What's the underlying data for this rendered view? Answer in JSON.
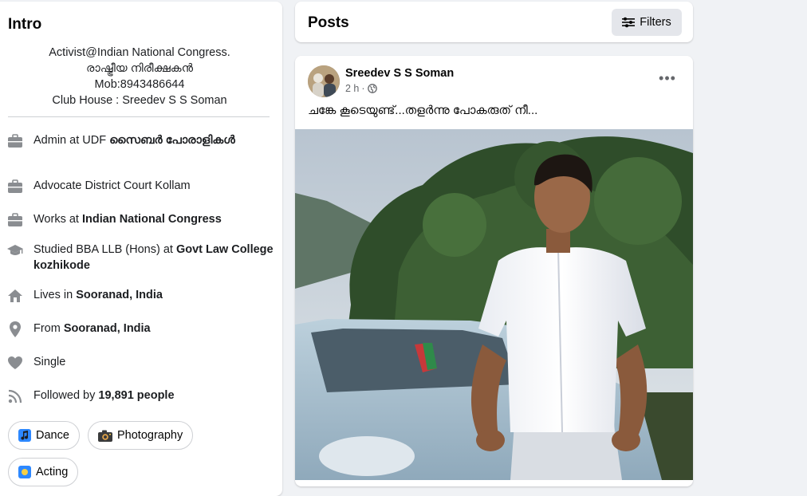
{
  "intro": {
    "title": "Intro",
    "bio": [
      "Activist@Indian National Congress.",
      "രാഷ്ട്രീയ നിരീക്ഷകൻ",
      "Mob:8943486644",
      "Club House : Sreedev S S Soman"
    ],
    "details": [
      {
        "icon": "briefcase-icon",
        "prefix": "Admin at UDF ",
        "bold": "സൈബർ പോരാളികൾ"
      },
      {
        "icon": "briefcase-icon",
        "prefix": "Advocate District Court Kollam",
        "bold": ""
      },
      {
        "icon": "briefcase-icon",
        "prefix": "Works at ",
        "bold": "Indian National Congress"
      },
      {
        "icon": "graduation-cap-icon",
        "prefix": "Studied BBA LLB (Hons) at ",
        "bold": "Govt Law College kozhikode"
      },
      {
        "icon": "home-icon",
        "prefix": "Lives in ",
        "bold": "Sooranad, India"
      },
      {
        "icon": "location-pin-icon",
        "prefix": "From ",
        "bold": "Sooranad, India"
      },
      {
        "icon": "heart-icon",
        "prefix": "Single",
        "bold": ""
      },
      {
        "icon": "rss-feed-icon",
        "prefix": "Followed by ",
        "bold": "19,891 people"
      }
    ],
    "hobbies": [
      {
        "icon": "music-note-icon",
        "label": "Dance"
      },
      {
        "icon": "camera-icon",
        "label": "Photography"
      },
      {
        "icon": "theater-masks-icon",
        "label": "Acting"
      }
    ]
  },
  "posts_header": {
    "title": "Posts",
    "filters_label": "Filters"
  },
  "post": {
    "author": "Sreedev S S Soman",
    "time": "2 h",
    "privacy_icon": "globe-icon",
    "caption": "ചങ്കേ കൂടെയുണ്ട്...തളർന്നു പോകരുത് നീ...",
    "photo_alt": "Man in white shirt standing in front of a car with trees behind"
  },
  "colors": {
    "background": "#f0f2f5",
    "card": "#ffffff",
    "secondary_text": "#65676b",
    "icon_gray": "#8a8d91",
    "button_gray": "#e4e6eb"
  }
}
